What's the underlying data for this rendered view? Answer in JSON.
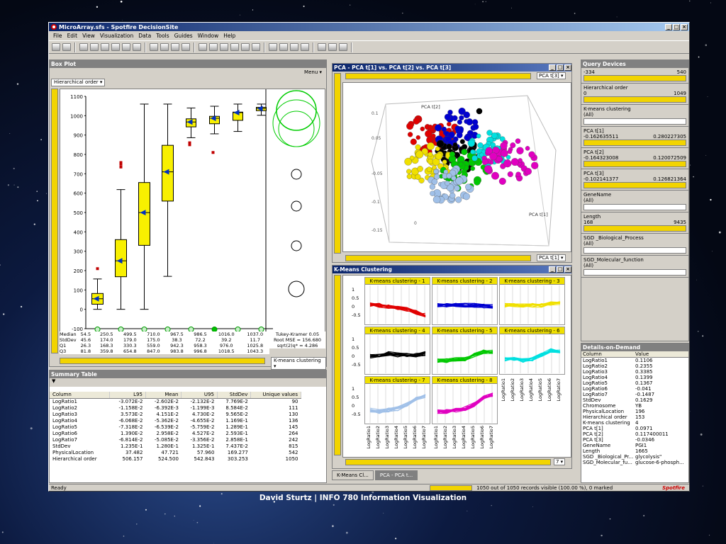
{
  "window": {
    "title": "MicroArray.sfs - Spotfire DecisionSite"
  },
  "menu": [
    "File",
    "Edit",
    "View",
    "Visualization",
    "Data",
    "Tools",
    "Guides",
    "Window",
    "Help"
  ],
  "box": {
    "title": "Box Plot",
    "menu": "Menu ▾",
    "order": "Hierarchical order ▾",
    "colorby": "K-means clustering ▾",
    "yticks": [
      "1100",
      "1000",
      "900",
      "800",
      "700",
      "600",
      "500",
      "400",
      "300",
      "200",
      "100",
      "0",
      "-100"
    ],
    "xcats": [
      "1",
      "2",
      "3",
      "4",
      "5",
      "6",
      "7",
      "8"
    ],
    "stats": {
      "labels": [
        "Median",
        "StdDev",
        "Q1",
        "Q3"
      ],
      "rows": [
        [
          "54.5",
          "250.5",
          "499.5",
          "710.0",
          "967.5",
          "986.5",
          "1016.0",
          "1037.0"
        ],
        [
          "45.6",
          "174.0",
          "179.0",
          "175.0",
          "38.3",
          "72.2",
          "39.2",
          "11.7"
        ],
        [
          "26.3",
          "168.3",
          "330.3",
          "559.0",
          "942.3",
          "958.3",
          "976.0",
          "1025.8"
        ],
        [
          "81.8",
          "359.8",
          "654.8",
          "847.0",
          "983.8",
          "996.8",
          "1018.5",
          "1043.3"
        ]
      ]
    },
    "tukey": [
      "Tukey-Kramer  0.05",
      "Root MSE = 156.680",
      "sqrt(2)q* = 4.286"
    ]
  },
  "chart_data": {
    "type": "box",
    "categories": [
      "1",
      "2",
      "3",
      "4",
      "5",
      "6",
      "7",
      "8"
    ],
    "median": [
      54.5,
      250.5,
      499.5,
      710.0,
      967.5,
      986.5,
      1016.0,
      1037.0
    ],
    "q1": [
      26.3,
      168.3,
      330.3,
      559.0,
      942.3,
      958.3,
      976.0,
      1025.8
    ],
    "q3": [
      81.8,
      359.8,
      654.8,
      847.0,
      983.8,
      996.8,
      1018.5,
      1043.3
    ],
    "ylim": [
      -100,
      1100
    ]
  },
  "summary": {
    "title": "Summary Table",
    "headers": [
      "Column",
      "L95",
      "Mean",
      "U95",
      "StdDev",
      "Unique values"
    ],
    "rows": [
      [
        "LogRatio1",
        "-3.072E-2",
        "-2.602E-2",
        "-2.132E-2",
        "7.769E-2",
        "90"
      ],
      [
        "LogRatio2",
        "-1.158E-2",
        "-6.392E-3",
        "-1.199E-3",
        "8.584E-2",
        "111"
      ],
      [
        "LogRatio3",
        "3.573E-2",
        "4.151E-2",
        "4.730E-2",
        "9.565E-2",
        "130"
      ],
      [
        "LogRatio4",
        "-6.068E-2",
        "-5.362E-2",
        "-4.655E-2",
        "1.169E-1",
        "136"
      ],
      [
        "LogRatio5",
        "-7.318E-2",
        "-6.539E-2",
        "-5.759E-2",
        "1.289E-1",
        "145"
      ],
      [
        "LogRatio6",
        "1.390E-2",
        "2.958E-2",
        "4.527E-2",
        "2.593E-1",
        "264"
      ],
      [
        "LogRatio7",
        "-6.814E-2",
        "-5.085E-2",
        "-3.356E-2",
        "2.858E-1",
        "242"
      ],
      [
        "StdDev",
        "1.235E-1",
        "1.280E-1",
        "1.325E-1",
        "7.437E-2",
        "815"
      ],
      [
        "PhysicalLocation",
        "37.482",
        "47.721",
        "57.960",
        "169.277",
        "542"
      ],
      [
        "Hierarchical order",
        "506.157",
        "524.500",
        "542.843",
        "303.253",
        "1050"
      ]
    ]
  },
  "pca": {
    "title": "PCA - PCA t[1] vs. PCA t[2] vs. PCA t[3]",
    "sel1": "PCA t[3] ▾",
    "sel2": "PCA t[1] ▾",
    "axlbl2": "PCA t[2]",
    "axlbl1": "PCA t[1]",
    "ticks": [
      "0.1",
      "0.05",
      "0",
      "-0.05",
      "-0.1",
      "-0.15",
      "0.15",
      "0.2",
      "0.25"
    ]
  },
  "kmeans": {
    "title": "K-Means Clustering",
    "cells": [
      "K-means clustering - 1",
      "K-means clustering - 2",
      "K-means clustering - 3",
      "K-means clustering - 4",
      "K-means clustering - 5",
      "K-means clustering - 6",
      "K-means clustering - 7",
      "K-means clustering - 8"
    ],
    "colors": [
      "#e00000",
      "#0000d0",
      "#f0e000",
      "#000000",
      "#00c800",
      "#00e0e0",
      "#a0c0e8",
      "#e000c0"
    ],
    "yticks": [
      "1",
      "0.5",
      "0",
      "-0.5"
    ],
    "xticks": [
      "LogRatio1",
      "LogRatio2",
      "LogRatio3",
      "LogRatio4",
      "LogRatio5",
      "LogRatio6",
      "LogRatio7"
    ],
    "pager": "7 ▾"
  },
  "query": {
    "title": "Query Devices",
    "top": {
      "min": "-334",
      "max": "540"
    },
    "items": [
      {
        "label": "Hierarchical order",
        "min": "0",
        "max": "1049"
      },
      {
        "label": "K-means clustering",
        "sub": "(All)"
      },
      {
        "label": "PCA t[1]",
        "min": "-0.162635511",
        "max": "0.280227305"
      },
      {
        "label": "PCA t[2]",
        "min": "-0.164323008",
        "max": "0.120072509"
      },
      {
        "label": "PCA t[3]",
        "min": "-0.102141377",
        "max": "0.126821364"
      },
      {
        "label": "GeneName",
        "sub": "(All)"
      },
      {
        "label": "Length",
        "min": "168",
        "max": "9435"
      },
      {
        "label": "SGD _Biological_Process",
        "sub": "(All)"
      },
      {
        "label": "SGD_Molecular_function",
        "sub": "(All)"
      }
    ]
  },
  "details": {
    "title": "Details-on-Demand",
    "headers": [
      "Column",
      "Value"
    ],
    "rows": [
      [
        "LogRatio1",
        "0.1106"
      ],
      [
        "LogRatio2",
        "0.2355"
      ],
      [
        "LogRatio3",
        "0.3385"
      ],
      [
        "LogRatio4",
        "0.1399"
      ],
      [
        "LogRatio5",
        "0.1367"
      ],
      [
        "LogRatio6",
        "-0.041"
      ],
      [
        "LogRatio7",
        "-0.1487"
      ],
      [
        "StdDev",
        "0.1629"
      ],
      [
        "Chromosome",
        "YB"
      ],
      [
        "PhysicalLocation",
        "196"
      ],
      [
        "Hierarchical order",
        "153"
      ],
      [
        "K-means clustering",
        "4"
      ],
      [
        "PCA t[1]",
        "0.0971"
      ],
      [
        "PCA t[2]",
        "0.117400011"
      ],
      [
        "PCA t[3]",
        "-0.0346"
      ],
      [
        "GeneName",
        "PGI1"
      ],
      [
        "Length",
        "1665"
      ],
      [
        "SGD _Biological_Pr...",
        "glycolysis\""
      ],
      [
        "SGD_Molecular_fu...",
        "glucose-6-phosph..."
      ]
    ]
  },
  "tabs": [
    "K-Means Cl...",
    "PCA - PCA t..."
  ],
  "status": {
    "ready": "Ready",
    "records": "1050 out of 1050 records visible (100.00 %), 0 marked",
    "logo": "Spotfire"
  },
  "footer": "David Sturtz | INFO 780 Information Visualization"
}
